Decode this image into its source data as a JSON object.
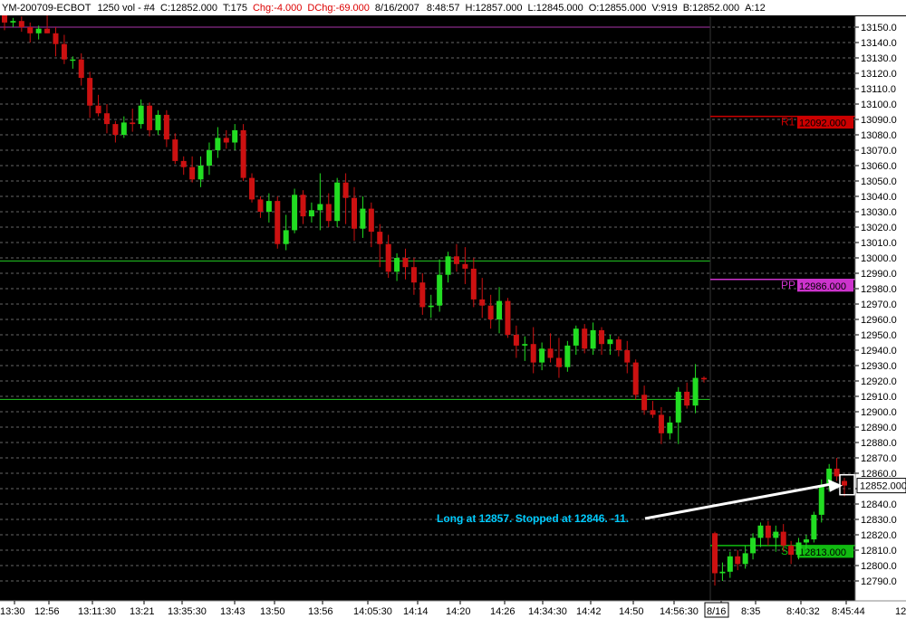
{
  "header": {
    "symbol": "YM-200709-ECBOT",
    "interval": "1250 vol - #4",
    "close": "C:12852.000",
    "ticks": "T:175",
    "chg": "Chg:-4.000",
    "dchg": "DChg:-69.000",
    "date": "8/16/2007",
    "time": "8:48:57",
    "high": "H:12857.000",
    "low": "L:12845.000",
    "open": "O:12855.000",
    "volume": "V:919",
    "bid": "B:12852.000",
    "ask": "A:12"
  },
  "colors": {
    "up": "#22dd22",
    "down": "#cc1111",
    "r1": "#cc0000",
    "pp": "#cc33cc",
    "s1": "#11bb11",
    "support_line": "#22cc22",
    "top_line": "#aa33aa",
    "annotation": "#00ccff"
  },
  "chart_data": {
    "type": "candlestick",
    "y_axis": {
      "min": 12785,
      "max": 13160,
      "tick_step": 10,
      "position": "right"
    },
    "x_tick_labels": [
      "13:30",
      "12:56",
      "13:11:30",
      "13:21",
      "13:35:30",
      "13:43",
      "13:50",
      "13:56",
      "14:05:30",
      "14:14",
      "14:20",
      "14:26",
      "14:34:30",
      "14:42",
      "14:50",
      "14:56:30",
      "8/16",
      "8:35",
      "8:40:32",
      "8:45:44",
      "12"
    ],
    "candles": [
      [
        13160,
        13158,
        13148,
        13153
      ],
      [
        13153,
        13156,
        13150,
        13154
      ],
      [
        13154,
        13157,
        13147,
        13150
      ],
      [
        13150,
        13153,
        13140,
        13146
      ],
      [
        13146,
        13151,
        13142,
        13149
      ],
      [
        13149,
        13159,
        13146,
        13146
      ],
      [
        13146,
        13150,
        13131,
        13139
      ],
      [
        13139,
        13145,
        13126,
        13129
      ],
      [
        13129,
        13131,
        13123,
        13129
      ],
      [
        13129,
        13133,
        13112,
        13117
      ],
      [
        13117,
        13121,
        13091,
        13099
      ],
      [
        13099,
        13106,
        13092,
        13094
      ],
      [
        13094,
        13100,
        13081,
        13087
      ],
      [
        13087,
        13089,
        13075,
        13080
      ],
      [
        13080,
        13092,
        13078,
        13088
      ],
      [
        13088,
        13097,
        13082,
        13087
      ],
      [
        13087,
        13103,
        13084,
        13099
      ],
      [
        13099,
        13101,
        13079,
        13083
      ],
      [
        13083,
        13096,
        13080,
        13093
      ],
      [
        13093,
        13096,
        13072,
        13077
      ],
      [
        13077,
        13081,
        13061,
        13063
      ],
      [
        13063,
        13066,
        13054,
        13059
      ],
      [
        13059,
        13066,
        13049,
        13051
      ],
      [
        13051,
        13066,
        13046,
        13060
      ],
      [
        13060,
        13075,
        13054,
        13070
      ],
      [
        13070,
        13085,
        13065,
        13078
      ],
      [
        13078,
        13083,
        13071,
        13075
      ],
      [
        13075,
        13087,
        13070,
        13083
      ],
      [
        13083,
        13087,
        13050,
        13052
      ],
      [
        13052,
        13055,
        13036,
        13038
      ],
      [
        13038,
        13040,
        13026,
        13030
      ],
      [
        13030,
        13042,
        13023,
        13037
      ],
      [
        13037,
        13040,
        13006,
        13009
      ],
      [
        13009,
        13028,
        13005,
        13018
      ],
      [
        13018,
        13045,
        13016,
        13041
      ],
      [
        13041,
        13044,
        13022,
        13027
      ],
      [
        13027,
        13036,
        13023,
        13031
      ],
      [
        13031,
        13055,
        13018,
        13035
      ],
      [
        13035,
        13042,
        13020,
        13024
      ],
      [
        13024,
        13052,
        13020,
        13049
      ],
      [
        13049,
        13055,
        13022,
        13039
      ],
      [
        13039,
        13046,
        13011,
        13019
      ],
      [
        13019,
        13040,
        13013,
        13032
      ],
      [
        13032,
        13036,
        13007,
        13017
      ],
      [
        13017,
        13022,
        12994,
        13009
      ],
      [
        13009,
        13015,
        12987,
        12991
      ],
      [
        12991,
        13003,
        12985,
        13000
      ],
      [
        13000,
        13006,
        12986,
        12994
      ],
      [
        12994,
        13000,
        12976,
        12984
      ],
      [
        12984,
        12990,
        12963,
        12968
      ],
      [
        12968,
        12976,
        12961,
        12969
      ],
      [
        12969,
        12999,
        12965,
        12989
      ],
      [
        12989,
        13004,
        12984,
        13001
      ],
      [
        13001,
        13009,
        12991,
        12996
      ],
      [
        12996,
        13007,
        12983,
        12993
      ],
      [
        12993,
        13000,
        12968,
        12973
      ],
      [
        12973,
        12987,
        12961,
        12969
      ],
      [
        12969,
        12976,
        12954,
        12960
      ],
      [
        12960,
        12981,
        12951,
        12972
      ],
      [
        12972,
        12974,
        12948,
        12950
      ],
      [
        12950,
        12956,
        12935,
        12943
      ],
      [
        12943,
        12949,
        12933,
        12944
      ],
      [
        12944,
        12955,
        12925,
        12932
      ],
      [
        12932,
        12945,
        12927,
        12941
      ],
      [
        12941,
        12951,
        12932,
        12935
      ],
      [
        12935,
        12948,
        12922,
        12929
      ],
      [
        12929,
        12946,
        12926,
        12943
      ],
      [
        12943,
        12956,
        12937,
        12954
      ],
      [
        12954,
        12957,
        12938,
        12941
      ],
      [
        12941,
        12958,
        12937,
        12953
      ],
      [
        12953,
        12955,
        12937,
        12944
      ],
      [
        12944,
        12950,
        12937,
        12947
      ],
      [
        12947,
        12949,
        12936,
        12940
      ],
      [
        12940,
        12946,
        12925,
        12932
      ],
      [
        12932,
        12934,
        12908,
        12911
      ],
      [
        12911,
        12917,
        12898,
        12901
      ],
      [
        12901,
        12907,
        12896,
        12898
      ],
      [
        12898,
        12903,
        12879,
        12886
      ],
      [
        12886,
        12897,
        12882,
        12893
      ],
      [
        12893,
        12916,
        12879,
        12913
      ],
      [
        12913,
        12919,
        12902,
        12904
      ],
      [
        12904,
        12931,
        12899,
        12922
      ],
      [
        12922,
        12923,
        12919,
        12921
      ],
      [
        12821,
        12822,
        12787,
        12795
      ],
      [
        12795,
        12802,
        12790,
        12796
      ],
      [
        12796,
        12809,
        12792,
        12806
      ],
      [
        12806,
        12810,
        12797,
        12801
      ],
      [
        12801,
        12813,
        12798,
        12808
      ],
      [
        12808,
        12821,
        12804,
        12818
      ],
      [
        12818,
        12828,
        12812,
        12826
      ],
      [
        12826,
        12829,
        12813,
        12818
      ],
      [
        12818,
        12826,
        12809,
        12822
      ],
      [
        12822,
        12827,
        12809,
        12813
      ],
      [
        12813,
        12816,
        12801,
        12807
      ],
      [
        12807,
        12818,
        12804,
        12815
      ],
      [
        12815,
        12820,
        12809,
        12817
      ],
      [
        12817,
        12835,
        12815,
        12833
      ],
      [
        12833,
        12856,
        12828,
        12852
      ],
      [
        12852,
        12866,
        12848,
        12863
      ],
      [
        12863,
        12870,
        12855,
        12858
      ],
      [
        12855,
        12857,
        12845,
        12852
      ]
    ],
    "levels": [
      {
        "label": "R1",
        "value_label": "12092.000",
        "value": 13092
      },
      {
        "label": "PP",
        "value_label": "12986.000",
        "value": 12986
      },
      {
        "label": "S1",
        "value_label": "12813.000",
        "value": 12813
      }
    ],
    "horizontal_lines": [
      {
        "value": 13150,
        "style": "top"
      },
      {
        "value": 12998,
        "style": "support"
      },
      {
        "value": 12908,
        "style": "support"
      }
    ],
    "last_price_label": "12852.000",
    "annotation": "Long at 12857.  Stopped at 12846.  -11."
  }
}
